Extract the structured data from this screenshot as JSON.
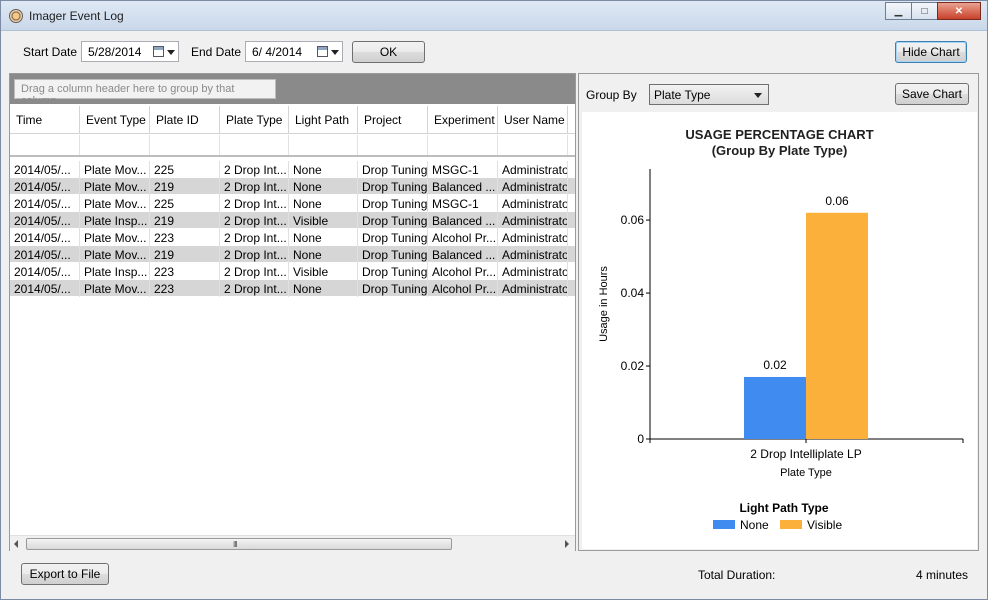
{
  "window": {
    "title": "Imager Event Log"
  },
  "toolbar": {
    "start_date_label": "Start Date",
    "start_date_value": "5/28/2014",
    "end_date_label": "End Date",
    "end_date_value": "6/ 4/2014",
    "ok_label": "OK",
    "hide_chart_label": "Hide Chart"
  },
  "grid": {
    "group_hint": "Drag a column header here to group by that column.",
    "columns": [
      "Time",
      "Event Type",
      "Plate ID",
      "Plate Type",
      "Light Path",
      "Project",
      "Experiment",
      "User Name"
    ],
    "rows": [
      [
        "2014/05/...",
        "Plate Mov...",
        "225",
        "2 Drop Int...",
        "None",
        "Drop Tuning",
        "MSGC-1",
        "Administrator"
      ],
      [
        "2014/05/...",
        "Plate Mov...",
        "219",
        "2 Drop Int...",
        "None",
        "Drop Tuning",
        "Balanced ...",
        "Administrator"
      ],
      [
        "2014/05/...",
        "Plate Mov...",
        "225",
        "2 Drop Int...",
        "None",
        "Drop Tuning",
        "MSGC-1",
        "Administrator"
      ],
      [
        "2014/05/...",
        "Plate Insp...",
        "219",
        "2 Drop Int...",
        "Visible",
        "Drop Tuning",
        "Balanced ...",
        "Administrator"
      ],
      [
        "2014/05/...",
        "Plate Mov...",
        "223",
        "2 Drop Int...",
        "None",
        "Drop Tuning",
        "Alcohol Pr...",
        "Administrator"
      ],
      [
        "2014/05/...",
        "Plate Mov...",
        "219",
        "2 Drop Int...",
        "None",
        "Drop Tuning",
        "Balanced ...",
        "Administrator"
      ],
      [
        "2014/05/...",
        "Plate Insp...",
        "223",
        "2 Drop Int...",
        "Visible",
        "Drop Tuning",
        "Alcohol Pr...",
        "Administrator"
      ],
      [
        "2014/05/...",
        "Plate Mov...",
        "223",
        "2 Drop Int...",
        "None",
        "Drop Tuning",
        "Alcohol Pr...",
        "Administrator"
      ]
    ],
    "scroll_grip": "III"
  },
  "chart_panel": {
    "group_by_label": "Group By",
    "group_by_value": "Plate Type",
    "save_chart_label": "Save Chart"
  },
  "chart_data": {
    "type": "bar",
    "title": "USAGE PERCENTAGE CHART",
    "subtitle": "(Group By Plate Type)",
    "xlabel": "Plate Type",
    "ylabel": "Usage in Hours",
    "categories": [
      "2 Drop Intelliplate LP"
    ],
    "series": [
      {
        "name": "None",
        "values": [
          0.017
        ],
        "label": "0.02",
        "color": "#3f8bef"
      },
      {
        "name": "Visible",
        "values": [
          0.062
        ],
        "label": "0.06",
        "color": "#fbb03b"
      }
    ],
    "ylim": [
      0,
      0.074
    ],
    "yticks": [
      0,
      0.02,
      0.04,
      0.06
    ],
    "ytick_labels": [
      "0",
      "0.02",
      "0.04",
      "0.06"
    ],
    "legend_title": "Light Path Type",
    "legend_position": "bottom-center",
    "grid": false
  },
  "footer": {
    "export_label": "Export to File",
    "total_duration_label": "Total Duration:",
    "total_duration_value": "4 minutes"
  }
}
